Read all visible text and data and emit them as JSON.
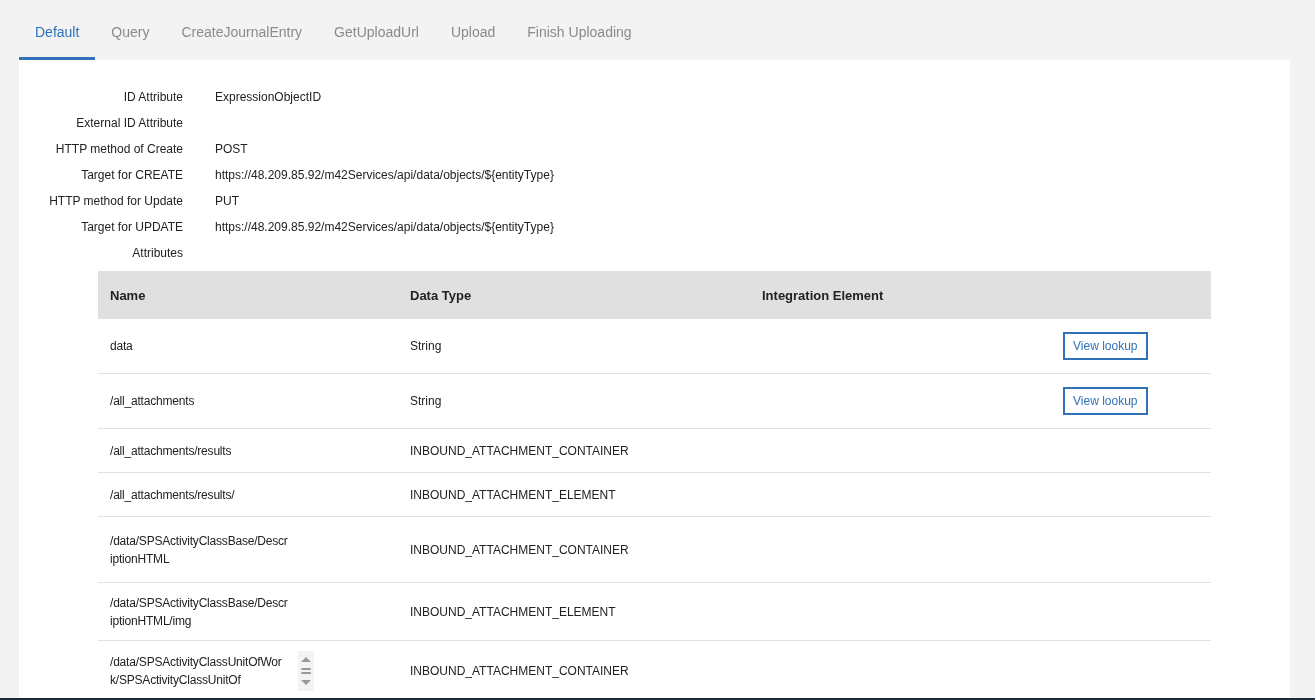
{
  "tabs": [
    {
      "label": "Default",
      "selected": true
    },
    {
      "label": "Query",
      "selected": false
    },
    {
      "label": "CreateJournalEntry",
      "selected": false
    },
    {
      "label": "GetUploadUrl",
      "selected": false
    },
    {
      "label": "Upload",
      "selected": false
    },
    {
      "label": "Finish Uploading",
      "selected": false
    }
  ],
  "fields": [
    {
      "label": "ID Attribute",
      "value": "ExpressionObjectID"
    },
    {
      "label": "External ID Attribute"
    },
    {
      "label": "HTTP method of Create",
      "value": "POST"
    },
    {
      "label": "Target for CREATE",
      "value": "https://48.209.85.92/m42Services/api/data/objects/${entityType}"
    },
    {
      "label": "HTTP method for Update",
      "value": "PUT"
    },
    {
      "label": "Target for UPDATE",
      "value": "https://48.209.85.92/m42Services/api/data/objects/${entityType}"
    },
    {
      "label": "Attributes"
    }
  ],
  "table": {
    "columns": [
      "Name",
      "Data Type",
      "Integration Element"
    ],
    "rows": [
      {
        "name": "data",
        "data_type": "String",
        "action": "View lookup"
      },
      {
        "name": "/all_attachments",
        "data_type": "String",
        "action": "View lookup"
      },
      {
        "name": "/all_attachments/results",
        "data_type": "INBOUND_ATTACHMENT_CONTAINER"
      },
      {
        "name": "/all_attachments/results/",
        "data_type": "INBOUND_ATTACHMENT_ELEMENT"
      },
      {
        "name": "/data/SPSActivityClassBase/DescriptionHTML",
        "data_type": "INBOUND_ATTACHMENT_CONTAINER"
      },
      {
        "name": "/data/SPSActivityClassBase/DescriptionHTML/img",
        "data_type": "INBOUND_ATTACHMENT_ELEMENT"
      },
      {
        "name": "/data/SPSActivityClassUnitOfWork/SPSActivityClassUnitOf",
        "data_type": "INBOUND_ATTACHMENT_CONTAINER",
        "scroller": true
      }
    ]
  }
}
